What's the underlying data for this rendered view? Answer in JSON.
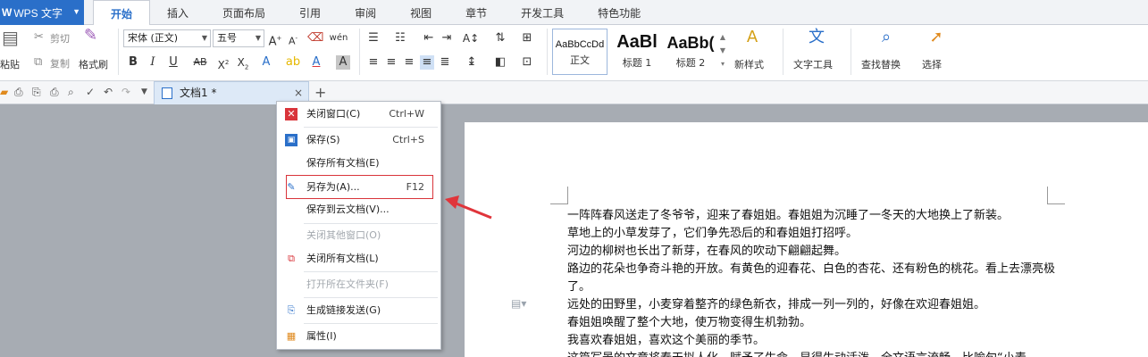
{
  "app": {
    "title": "WPS 文字"
  },
  "tabs": [
    "开始",
    "插入",
    "页面布局",
    "引用",
    "审阅",
    "视图",
    "章节",
    "开发工具",
    "特色功能"
  ],
  "ribbon": {
    "paste": "粘贴",
    "cut": "剪切",
    "copy": "复制",
    "format_painter": "格式刷",
    "font_name": "宋体 (正文)",
    "font_size": "五号",
    "styles": [
      {
        "preview": "AaBbCcDd",
        "label": "正文"
      },
      {
        "preview": "AaBl",
        "label": "标题 1"
      },
      {
        "preview": "AaBb(",
        "label": "标题 2"
      }
    ],
    "new_style": "新样式",
    "text_tools": "文字工具",
    "find_replace": "查找替换",
    "select": "选择"
  },
  "document_tab": {
    "name": "文档1 *"
  },
  "context_menu": {
    "items": [
      {
        "label": "关闭窗口(C)",
        "shortcut": "Ctrl+W",
        "icon": "close-window-icon",
        "disabled": false
      },
      {
        "label": "保存(S)",
        "shortcut": "Ctrl+S",
        "icon": "save-icon",
        "disabled": false
      },
      {
        "label": "保存所有文档(E)",
        "shortcut": "",
        "icon": "",
        "disabled": false
      },
      {
        "label": "另存为(A)...",
        "shortcut": "F12",
        "icon": "save-as-icon",
        "disabled": false
      },
      {
        "label": "保存到云文档(V)...",
        "shortcut": "",
        "icon": "",
        "disabled": false
      },
      {
        "label": "关闭其他窗口(O)",
        "shortcut": "",
        "icon": "",
        "disabled": true
      },
      {
        "label": "关闭所有文档(L)",
        "shortcut": "",
        "icon": "close-all-icon",
        "disabled": false
      },
      {
        "label": "打开所在文件夹(F)",
        "shortcut": "",
        "icon": "",
        "disabled": true
      },
      {
        "label": "生成链接发送(G)",
        "shortcut": "",
        "icon": "share-link-icon",
        "disabled": false
      },
      {
        "label": "属性(I)",
        "shortcut": "",
        "icon": "properties-icon",
        "disabled": false
      }
    ]
  },
  "document": {
    "lines": [
      "一阵阵春风送走了冬爷爷，迎来了春姐姐。春姐姐为沉睡了一冬天的大地换上了新装。",
      "草地上的小草发芽了，它们争先恐后的和春姐姐打招呼。",
      "河边的柳树也长出了新芽，在春风的吹动下翩翩起舞。",
      "路边的花朵也争奇斗艳的开放。有黄色的迎春花、白色的杏花、还有粉色的桃花。看上去漂亮极了。",
      "远处的田野里，小麦穿着整齐的绿色新衣，排成一列一列的，好像在欢迎春姐姐。",
      "春姐姐唤醒了整个大地，使万物变得生机勃勃。",
      "我喜欢春姐姐，喜欢这个美丽的季节。",
      "这篇写景的文章将春天拟人化，赋予了生命，显得生动活泼，全文语言流畅，比喻句“小麦"
    ]
  },
  "colors": {
    "accent": "#2a6fc9",
    "highlight_box": "#d9343a",
    "arrow": "#e0353b"
  }
}
